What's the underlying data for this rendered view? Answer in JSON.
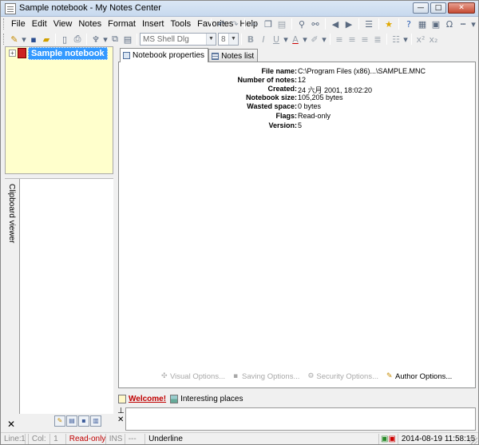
{
  "window": {
    "title": "Sample notebook - My Notes Center",
    "controls": [
      "—",
      "□",
      "✕"
    ]
  },
  "menu": [
    "File",
    "Edit",
    "View",
    "Notes",
    "Format",
    "Insert",
    "Tools",
    "Favorites",
    "Help"
  ],
  "toolbar": {
    "font_name": "MS Shell Dlg",
    "font_size": "8",
    "bold": "B",
    "italic": "I",
    "underline": "U",
    "font_color": "A"
  },
  "tree": {
    "root_label": "Sample notebook",
    "expander": "+"
  },
  "clipboard": {
    "title": "Clipboard viewer",
    "close": "✕"
  },
  "tabs": [
    {
      "label": "Notebook properties"
    },
    {
      "label": "Notes list"
    }
  ],
  "properties": [
    {
      "label": "File name:",
      "value": "C:\\Program Files (x86)...\\SAMPLE.MNC"
    },
    {
      "label": "Number of notes:",
      "value": "12"
    },
    {
      "label": "Created:",
      "value": "24 六月 2001, 18:02:20"
    },
    {
      "label": "Notebook size:",
      "value": "105,205 bytes"
    },
    {
      "label": "Wasted space:",
      "value": "0 bytes"
    },
    {
      "label": "Flags:",
      "value": "Read-only"
    },
    {
      "label": "Version:",
      "value": "5"
    }
  ],
  "options": [
    {
      "label": "Visual Options...",
      "enabled": false
    },
    {
      "label": "Saving Options...",
      "enabled": false
    },
    {
      "label": "Security Options...",
      "enabled": false
    },
    {
      "label": "Author Options...",
      "enabled": true
    }
  ],
  "note_tabs": [
    {
      "label": "Welcome!"
    },
    {
      "label": "Interesting places"
    }
  ],
  "note_side": {
    "pin": "⊥",
    "close": "✕"
  },
  "status": {
    "line_label": "Line:",
    "line": "1",
    "col_label": "Col:",
    "col": "1",
    "mode": "Read-only",
    "ins": "INS",
    "dashes": "---",
    "style": "Underline",
    "datetime": "2014-08-19 11:58:15"
  },
  "colors": {
    "tree_bg": "#ffffcc",
    "selection": "#3399ff",
    "status_red": "#c00000"
  }
}
